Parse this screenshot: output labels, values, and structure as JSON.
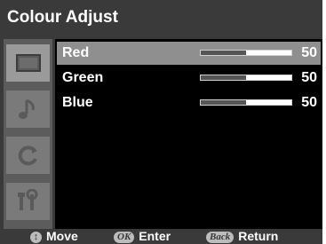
{
  "menu": {
    "title": "Colour Adjust"
  },
  "sidebar": {
    "items": [
      {
        "icon": "picture-icon",
        "active": true
      },
      {
        "icon": "sound-icon",
        "active": false
      },
      {
        "icon": "setup-icon",
        "active": false
      },
      {
        "icon": "tools-icon",
        "active": false
      }
    ]
  },
  "settings": [
    {
      "label": "Red",
      "value": "50",
      "level": 0.5,
      "selected": true
    },
    {
      "label": "Green",
      "value": "50",
      "level": 0.5,
      "selected": false
    },
    {
      "label": "Blue",
      "value": "50",
      "level": 0.5,
      "selected": false
    }
  ],
  "footer": {
    "move": {
      "key": "",
      "label": "Move"
    },
    "enter": {
      "key": "OK",
      "label": "Enter"
    },
    "return": {
      "key": "Back",
      "label": "Return"
    }
  }
}
